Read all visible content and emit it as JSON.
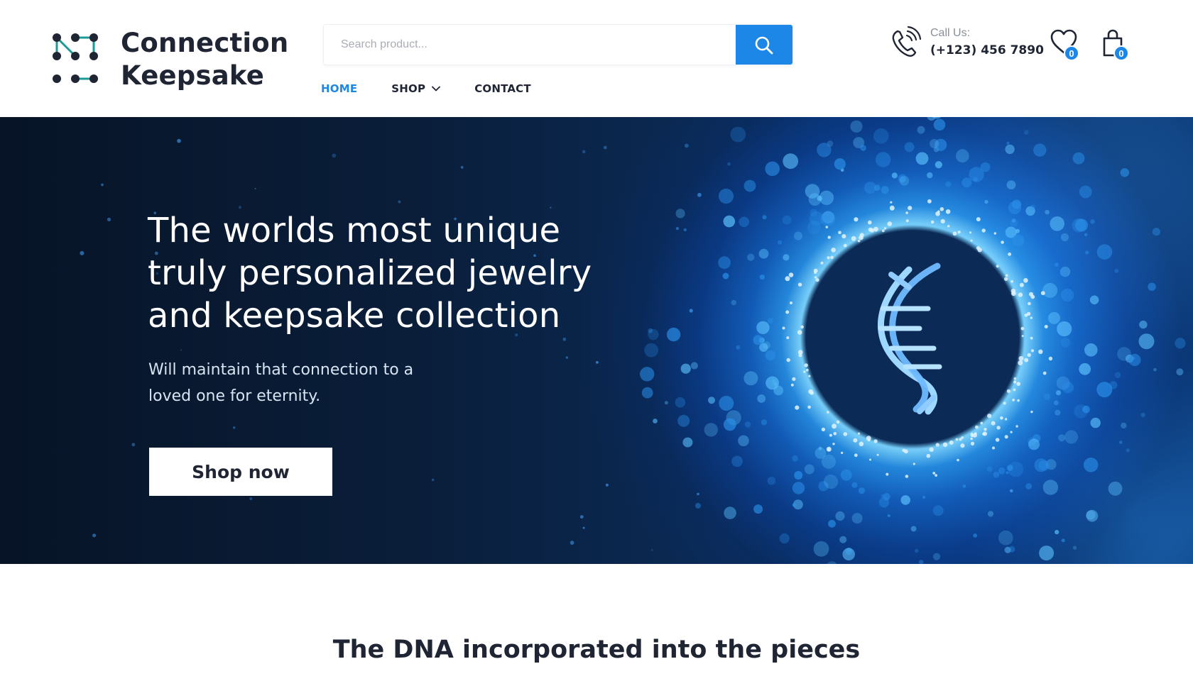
{
  "brand": {
    "name_line1": "Connection",
    "name_line2": "Keepsake",
    "logo_icon": "connected-dots-logo",
    "accent_color": "#1c87e6",
    "text_color": "#1f2533"
  },
  "search": {
    "placeholder": "Search product...",
    "value": "",
    "button_icon": "search-icon"
  },
  "nav": {
    "items": [
      {
        "label": "HOME",
        "active": true
      },
      {
        "label": "SHOP",
        "active": false,
        "has_dropdown": true
      },
      {
        "label": "CONTACT",
        "active": false
      }
    ]
  },
  "contact": {
    "icon": "phone-icon",
    "label": "Call Us:",
    "phone": "(+123) 456 7890"
  },
  "wishlist": {
    "icon": "heart-icon",
    "count": "0"
  },
  "cart": {
    "icon": "shopping-bag-icon",
    "count": "0"
  },
  "hero": {
    "title_line1": "The worlds most unique",
    "title_line2": "truly personalized jewelry",
    "title_line3": "and keepsake collection",
    "subtitle_line1": "Will maintain that connection to a",
    "subtitle_line2": "loved one for eternity.",
    "button_label": "Shop now",
    "graphic_icon": "dna-helix-icon"
  },
  "section": {
    "heading": "The DNA incorporated into the pieces"
  }
}
